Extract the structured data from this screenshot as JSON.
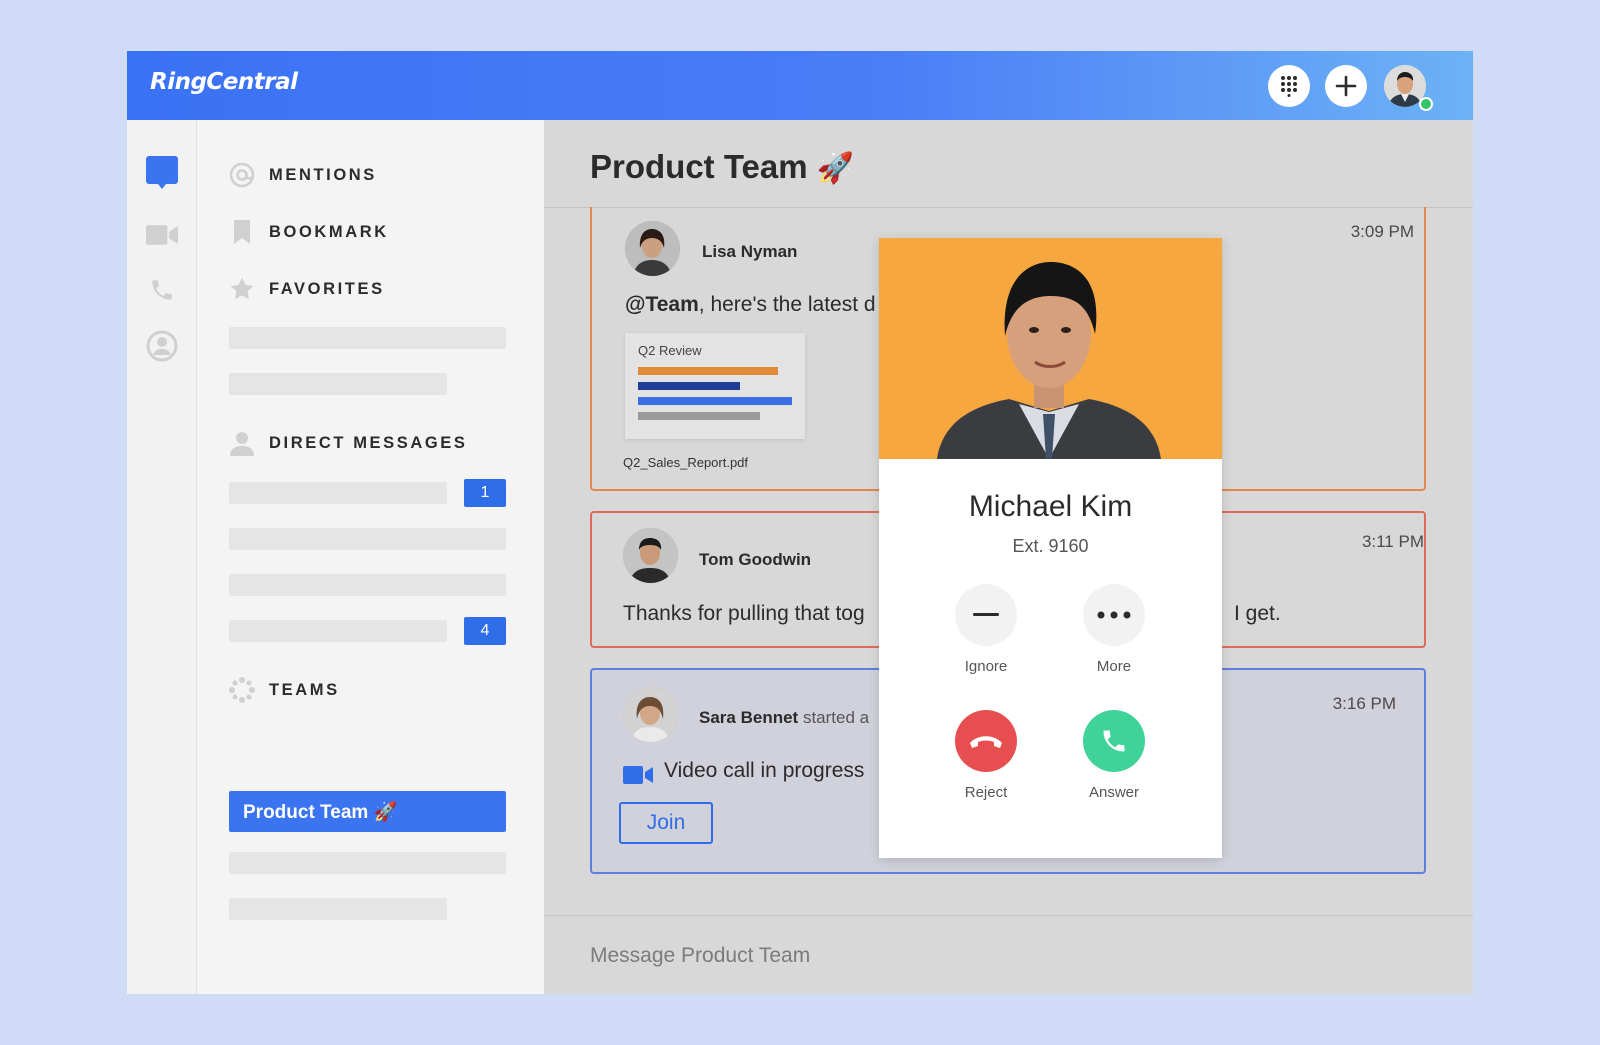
{
  "topbar": {
    "logo_text": "RingCentral",
    "dialpad_icon": "dialpad-icon",
    "add_icon": "plus-icon"
  },
  "rail": {
    "items": [
      "message-icon",
      "video-icon",
      "phone-icon",
      "contacts-icon"
    ]
  },
  "sidebar": {
    "mentions_label": "MENTIONS",
    "bookmark_label": "BOOKMARK",
    "favorites_label": "FAVORITES",
    "direct_messages_label": "DIRECT MESSAGES",
    "dm_badges": [
      "1",
      "4"
    ],
    "teams_label": "TEAMS",
    "active_team": "Product Team 🚀"
  },
  "main": {
    "title": "Product Team",
    "title_emoji": "🚀",
    "messages": [
      {
        "author": "Lisa Nyman",
        "time": "3:09 PM",
        "text_mention": "@Team",
        "text": ", here's the latest d",
        "attachment_title": "Q2 Review",
        "attachment_filename": "Q2_Sales_Report.pdf"
      },
      {
        "author": "Tom Goodwin",
        "time": "3:11 PM",
        "text": "Thanks for pulling that tog",
        "text_tail": "I get."
      },
      {
        "author": "Sara Bennet",
        "author_suffix": "started a",
        "time": "3:16 PM",
        "text": "Video call in progress",
        "join_label": "Join"
      }
    ],
    "composer_placeholder": "Message Product Team"
  },
  "incoming_call": {
    "caller_name": "Michael Kim",
    "caller_ext": "Ext. 9160",
    "ignore_label": "Ignore",
    "more_label": "More",
    "reject_label": "Reject",
    "answer_label": "Answer"
  },
  "colors": {
    "brand_blue": "#3a72f5",
    "orange": "#f7a740",
    "reject_red": "#e64e50",
    "answer_green": "#3fd39a",
    "badge_blue": "#2f6ee8"
  }
}
